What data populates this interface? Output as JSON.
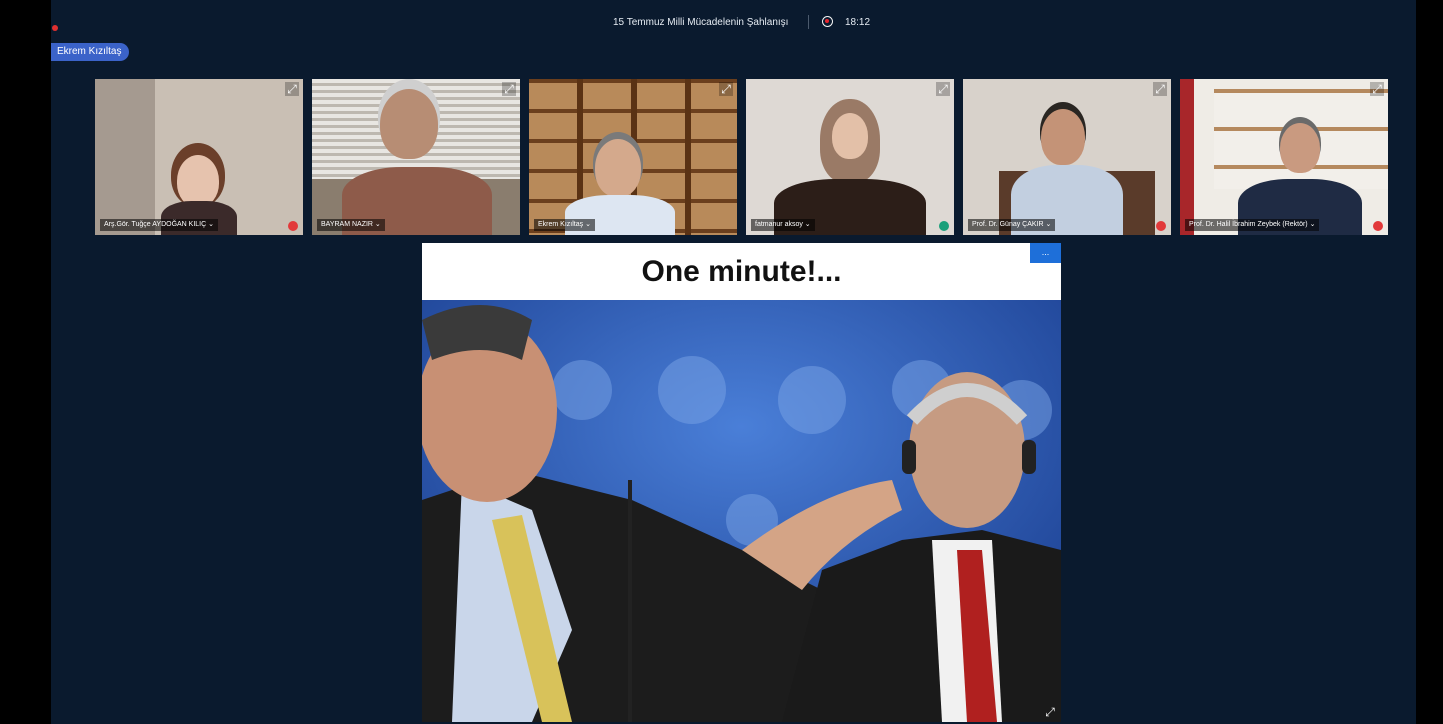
{
  "meeting": {
    "title": "15 Temmuz Milli Mücadelenin Şahlanışı",
    "timer": "18:12",
    "active_speaker": "Ekrem Kızıltaş"
  },
  "participants": [
    {
      "name": "Arş.Gör. Tuğçe AYDOĞAN KILIÇ ⌄",
      "mic": "muted"
    },
    {
      "name": "BAYRAM NAZIR ⌄",
      "mic": "none"
    },
    {
      "name": "Ekrem Kızıltaş ⌄",
      "mic": "none"
    },
    {
      "name": "fatmanur aksoy ⌄",
      "mic": "on"
    },
    {
      "name": "Prof. Dr. Günay ÇAKIR ⌄",
      "mic": "muted"
    },
    {
      "name": "Prof. Dr. Halil İbrahim Zeybek (Rektör) ⌄",
      "mic": "muted"
    }
  ],
  "slide": {
    "title": "One minute!...",
    "menu_label": "..."
  },
  "icons": {
    "expand": "expand-icon",
    "record": "record-icon",
    "mic_muted": "mic-muted-icon",
    "mic_on": "mic-on-icon"
  },
  "colors": {
    "background": "#0a1a2e",
    "badge": "#3b63c9",
    "record": "#e8252d",
    "mic_muted": "#e2393a",
    "mic_on": "#1aa07a"
  }
}
